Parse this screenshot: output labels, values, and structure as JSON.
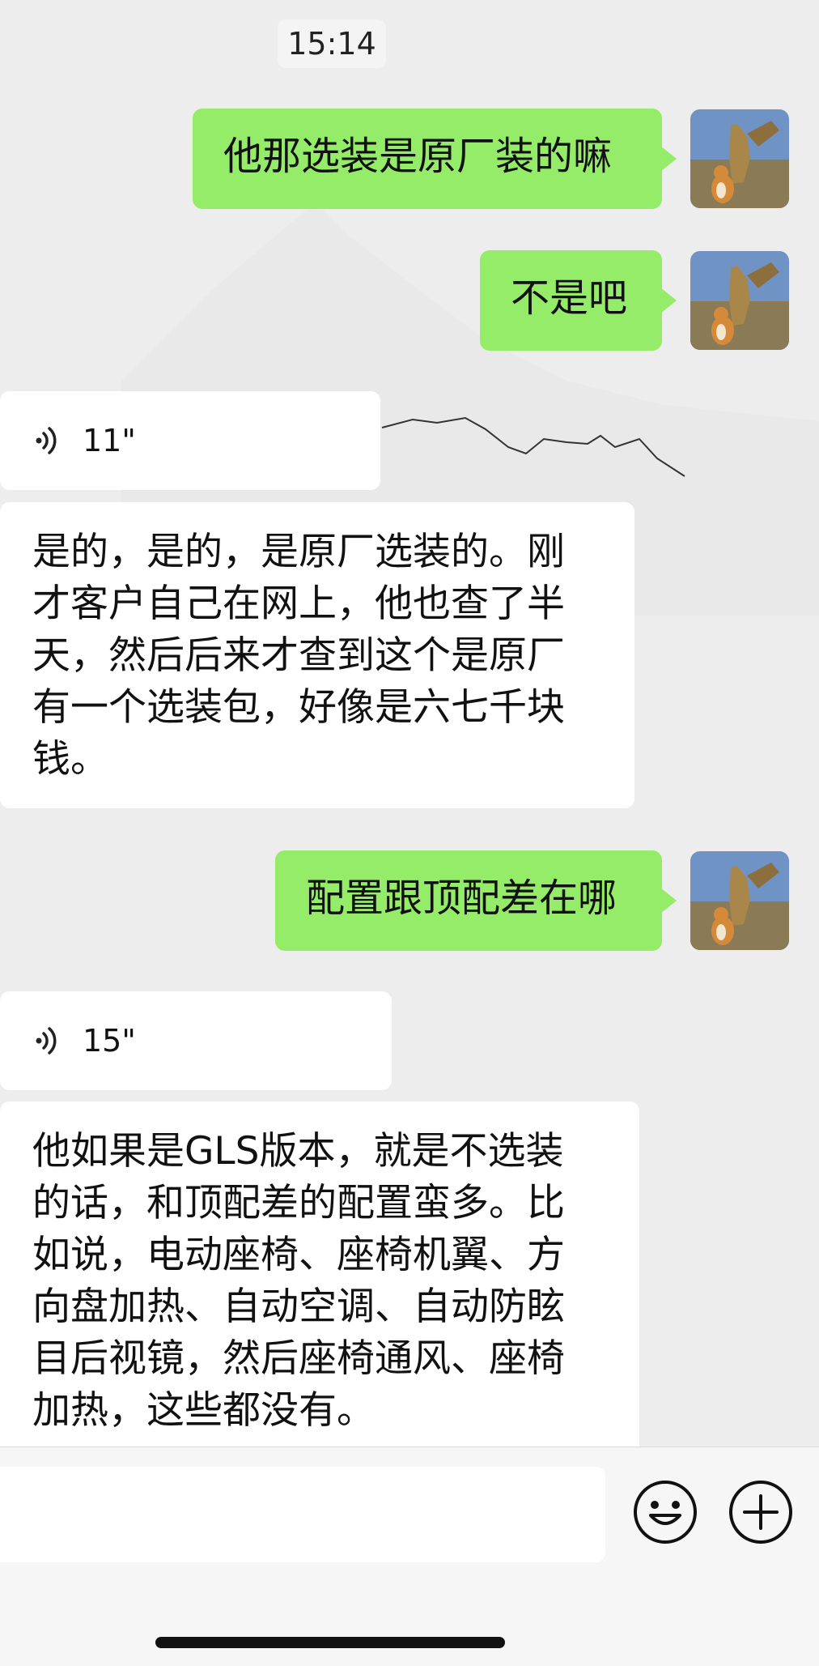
{
  "timestamp": "15:14",
  "messages": {
    "m1": {
      "direction": "out",
      "text": "他那选装是原厂装的嘛"
    },
    "m2": {
      "direction": "out",
      "text": "不是吧"
    },
    "m3": {
      "direction": "in",
      "type": "voice",
      "duration": "11\""
    },
    "m4": {
      "direction": "in",
      "type": "text",
      "lines": [
        "是的，是的，是原厂选装的。刚",
        "才客户自己在网上，他也查了半",
        "天，然后后来才查到这个是原厂",
        "有一个选装包，好像是六七千块",
        "钱。"
      ]
    },
    "m5": {
      "direction": "out",
      "text": "配置跟顶配差在哪"
    },
    "m6": {
      "direction": "in",
      "type": "voice",
      "duration": "15\""
    },
    "m7": {
      "direction": "in",
      "type": "text",
      "lines": [
        "他如果是GLS版本，就是不选装",
        "的话，和顶配差的配置蛮多。比",
        "如说，电动座椅、座椅机翼、方",
        "向盘加热、自动空调、自动防眩",
        "目后视镜，然后座椅通风、座椅",
        "加热，这些都没有。"
      ]
    }
  },
  "input_bar": {
    "emoji_icon": "smile-icon",
    "plus_icon": "plus-icon"
  },
  "colors": {
    "outgoing_bubble": "#95ec69",
    "incoming_bubble": "#ffffff",
    "background": "#ededed"
  }
}
